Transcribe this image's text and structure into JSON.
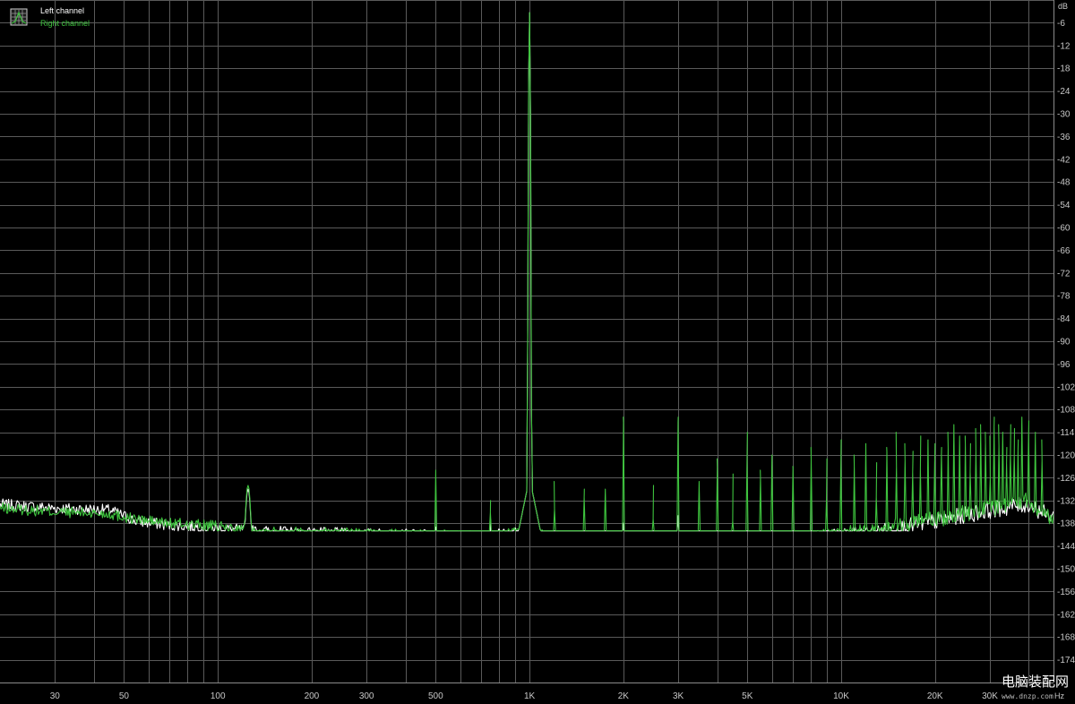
{
  "chart_data": {
    "type": "line",
    "title": "",
    "x_unit": "Hz",
    "y_unit": "dB",
    "x_scale": "log",
    "xlim": [
      20,
      48000
    ],
    "ylim": [
      -180,
      0
    ],
    "grid": true,
    "legend_position": "top-left",
    "x_tick_labels": [
      {
        "value": 30,
        "label": "30"
      },
      {
        "value": 50,
        "label": "50"
      },
      {
        "value": 100,
        "label": "100"
      },
      {
        "value": 200,
        "label": "200"
      },
      {
        "value": 300,
        "label": "300"
      },
      {
        "value": 500,
        "label": "500"
      },
      {
        "value": 1000,
        "label": "1K"
      },
      {
        "value": 2000,
        "label": "2K"
      },
      {
        "value": 3000,
        "label": "3K"
      },
      {
        "value": 5000,
        "label": "5K"
      },
      {
        "value": 10000,
        "label": "10K"
      },
      {
        "value": 20000,
        "label": "20K"
      },
      {
        "value": 30000,
        "label": "30K"
      }
    ],
    "y_ticks": [
      -6,
      -12,
      -18,
      -24,
      -30,
      -36,
      -42,
      -48,
      -54,
      -60,
      -66,
      -72,
      -78,
      -84,
      -90,
      -96,
      -102,
      -108,
      -114,
      -120,
      -126,
      -132,
      -138,
      -144,
      -150,
      -156,
      -162,
      -168,
      -174
    ],
    "series": [
      {
        "name": "Left channel",
        "color": "#ffffff",
        "noise_floor": [
          [
            20,
            -133
          ],
          [
            30,
            -134
          ],
          [
            45,
            -134.5
          ],
          [
            55,
            -137.5
          ],
          [
            70,
            -138.5
          ],
          [
            90,
            -139
          ],
          [
            130,
            -140
          ],
          [
            200,
            -140.5
          ],
          [
            400,
            -141
          ],
          [
            700,
            -141.5
          ],
          [
            900,
            -140.5
          ],
          [
            1100,
            -142
          ],
          [
            1500,
            -143
          ],
          [
            2500,
            -143.5
          ],
          [
            4000,
            -143.5
          ],
          [
            6000,
            -143
          ],
          [
            9000,
            -142
          ],
          [
            13000,
            -140.5
          ],
          [
            20000,
            -137.5
          ],
          [
            30000,
            -134.5
          ],
          [
            40000,
            -133
          ],
          [
            46000,
            -136
          ]
        ],
        "peaks": [
          [
            125,
            -129
          ],
          [
            500,
            -139
          ],
          [
            750,
            -137
          ],
          [
            1000,
            -3
          ],
          [
            2000,
            -138
          ],
          [
            3000,
            -136
          ]
        ]
      },
      {
        "name": "Right channel",
        "color": "#3ec43e",
        "noise_floor": [
          [
            20,
            -134
          ],
          [
            30,
            -135
          ],
          [
            45,
            -135.5
          ],
          [
            55,
            -137
          ],
          [
            70,
            -138
          ],
          [
            90,
            -138.5
          ],
          [
            130,
            -140
          ],
          [
            200,
            -140.5
          ],
          [
            400,
            -141
          ],
          [
            700,
            -141.5
          ],
          [
            900,
            -140.5
          ],
          [
            1100,
            -142
          ],
          [
            1500,
            -143
          ],
          [
            2500,
            -143
          ],
          [
            4000,
            -143
          ],
          [
            6000,
            -142.5
          ],
          [
            9000,
            -141.5
          ],
          [
            13000,
            -140
          ],
          [
            20000,
            -137
          ],
          [
            30000,
            -134
          ],
          [
            40000,
            -132
          ],
          [
            46000,
            -136
          ]
        ],
        "peaks": [
          [
            125,
            -128
          ],
          [
            500,
            -124
          ],
          [
            750,
            -132
          ],
          [
            1000,
            -3
          ],
          [
            1200,
            -127
          ],
          [
            1500,
            -129
          ],
          [
            1750,
            -129
          ],
          [
            2000,
            -110
          ],
          [
            2500,
            -128
          ],
          [
            3000,
            -110
          ],
          [
            3500,
            -127
          ],
          [
            4000,
            -121
          ],
          [
            4500,
            -125
          ],
          [
            5000,
            -114
          ],
          [
            5500,
            -124
          ],
          [
            6000,
            -120
          ],
          [
            7000,
            -123
          ],
          [
            8000,
            -118
          ],
          [
            9000,
            -121
          ],
          [
            10000,
            -116
          ],
          [
            11000,
            -120
          ],
          [
            12000,
            -117
          ],
          [
            13000,
            -122
          ],
          [
            14000,
            -118
          ],
          [
            15000,
            -114
          ],
          [
            16000,
            -117
          ],
          [
            17000,
            -119
          ],
          [
            18000,
            -115
          ],
          [
            19000,
            -116
          ],
          [
            20000,
            -117
          ],
          [
            21000,
            -118
          ],
          [
            22000,
            -114
          ],
          [
            23000,
            -112
          ],
          [
            24000,
            -115
          ],
          [
            25000,
            -115
          ],
          [
            26000,
            -117
          ],
          [
            27000,
            -113
          ],
          [
            28000,
            -112
          ],
          [
            29000,
            -114
          ],
          [
            30000,
            -115
          ],
          [
            31000,
            -110
          ],
          [
            32000,
            -112
          ],
          [
            33000,
            -114
          ],
          [
            34000,
            -118
          ],
          [
            35000,
            -112
          ],
          [
            36000,
            -113
          ],
          [
            37000,
            -116
          ],
          [
            38000,
            -110
          ],
          [
            40000,
            -111
          ],
          [
            42000,
            -114
          ],
          [
            44000,
            -116
          ]
        ]
      }
    ]
  },
  "watermark": {
    "main_text": "电脑装配网",
    "sub_text": "www.dnzp.com"
  }
}
